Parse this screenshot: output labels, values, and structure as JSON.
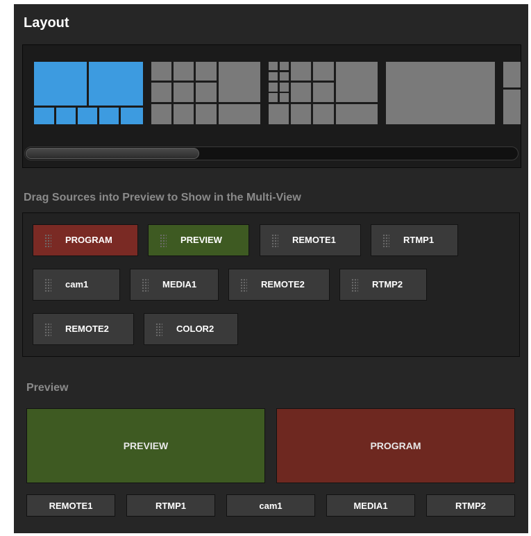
{
  "panel": {
    "title": "Layout"
  },
  "layouts": [
    {
      "name": "1 large + 2 side, 5 small",
      "selected": true
    },
    {
      "name": "grid variant 1",
      "selected": false
    },
    {
      "name": "grid variant 2",
      "selected": false
    },
    {
      "name": "single",
      "selected": false
    },
    {
      "name": "partial",
      "selected": false
    }
  ],
  "sources": {
    "heading": "Drag Sources into Preview to Show in the Multi-View",
    "chips": [
      {
        "label": "PROGRAM",
        "kind": "program"
      },
      {
        "label": "PREVIEW",
        "kind": "preview"
      },
      {
        "label": "REMOTE1",
        "kind": "normal"
      },
      {
        "label": "RTMP1",
        "kind": "normal"
      },
      {
        "label": "cam1",
        "kind": "normal"
      },
      {
        "label": "MEDIA1",
        "kind": "normal"
      },
      {
        "label": "REMOTE2",
        "kind": "normal"
      },
      {
        "label": "RTMP2",
        "kind": "normal"
      },
      {
        "label": "REMOTE2",
        "kind": "normal"
      },
      {
        "label": "COLOR2",
        "kind": "normal"
      }
    ]
  },
  "preview": {
    "heading": "Preview",
    "large": [
      {
        "label": "PREVIEW"
      },
      {
        "label": "PROGRAM"
      }
    ],
    "small": [
      {
        "label": "REMOTE1"
      },
      {
        "label": "RTMP1"
      },
      {
        "label": "cam1"
      },
      {
        "label": "MEDIA1"
      },
      {
        "label": "RTMP2"
      }
    ]
  },
  "colors": {
    "background": "#262626",
    "selected_layout": "#3d9be0",
    "layout_cell": "#7a7a7a",
    "program": "#7a2a24",
    "preview": "#3e5a22"
  }
}
